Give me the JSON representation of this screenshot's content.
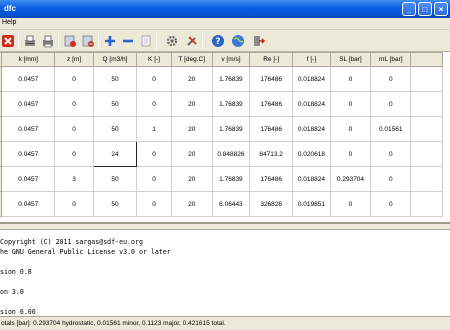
{
  "window": {
    "title": "dfc",
    "controls": [
      "_",
      "□",
      "×"
    ]
  },
  "menu": {
    "help_label": "Help"
  },
  "toolbar": {
    "icons": [
      "delete-icon",
      "print-preview-icon",
      "print-icon",
      "open-file-icon",
      "save-file-icon",
      "add-row-icon",
      "remove-row-icon",
      "clear-icon",
      "settings-icon",
      "tools-icon",
      "help-icon",
      "web-icon",
      "exit-icon"
    ]
  },
  "table": {
    "headers": [
      "k [mm]",
      "z [m]",
      "Q [m3/h]",
      "K [-]",
      "T [deg.C]",
      "v [m/s]",
      "Re [-]",
      "f [-]",
      "SL [bar]",
      "mL [bar]"
    ],
    "rows": [
      [
        "0.0457",
        "0",
        "50",
        "0",
        "20",
        "1.76839",
        "176486",
        "0.018824",
        "0",
        "0"
      ],
      [
        "0.0457",
        "0",
        "50",
        "0",
        "20",
        "1.76839",
        "176486",
        "0.018824",
        "0",
        "0"
      ],
      [
        "0.0457",
        "0",
        "50",
        "1",
        "20",
        "1.76839",
        "176486",
        "0.018824",
        "0",
        "0.01561"
      ],
      [
        "0.0457",
        "0",
        "24",
        "0",
        "20",
        "0.848826",
        "84713.2",
        "0.020618",
        "0",
        "0"
      ],
      [
        "0.0457",
        "3",
        "50",
        "0",
        "20",
        "1.76839",
        "176486",
        "0.018824",
        "0.293704",
        "0"
      ],
      [
        "0.0457",
        "0",
        "50",
        "0",
        "20",
        "6.06443",
        "326826",
        "0.019851",
        "0",
        "0"
      ]
    ],
    "selected_cell": {
      "row": 3,
      "col": 2
    }
  },
  "console": {
    "lines": [
      "Copyright (C) 2011 sargas@sdf-eu.org",
      "he GNU General Public License v3.0 or later",
      "",
      "sion 0.8",
      "",
      "on 3.0",
      "",
      "sion 6.00"
    ]
  },
  "status": {
    "text": "otals [bar]: 0.293704 hydrostatic, 0.01561 minor, 0.1123 major, 0.421615 total."
  },
  "colors": {
    "titlebar": "#0b5de1",
    "chrome": "#ece9d8",
    "grid_border": "#d4d0c8"
  }
}
